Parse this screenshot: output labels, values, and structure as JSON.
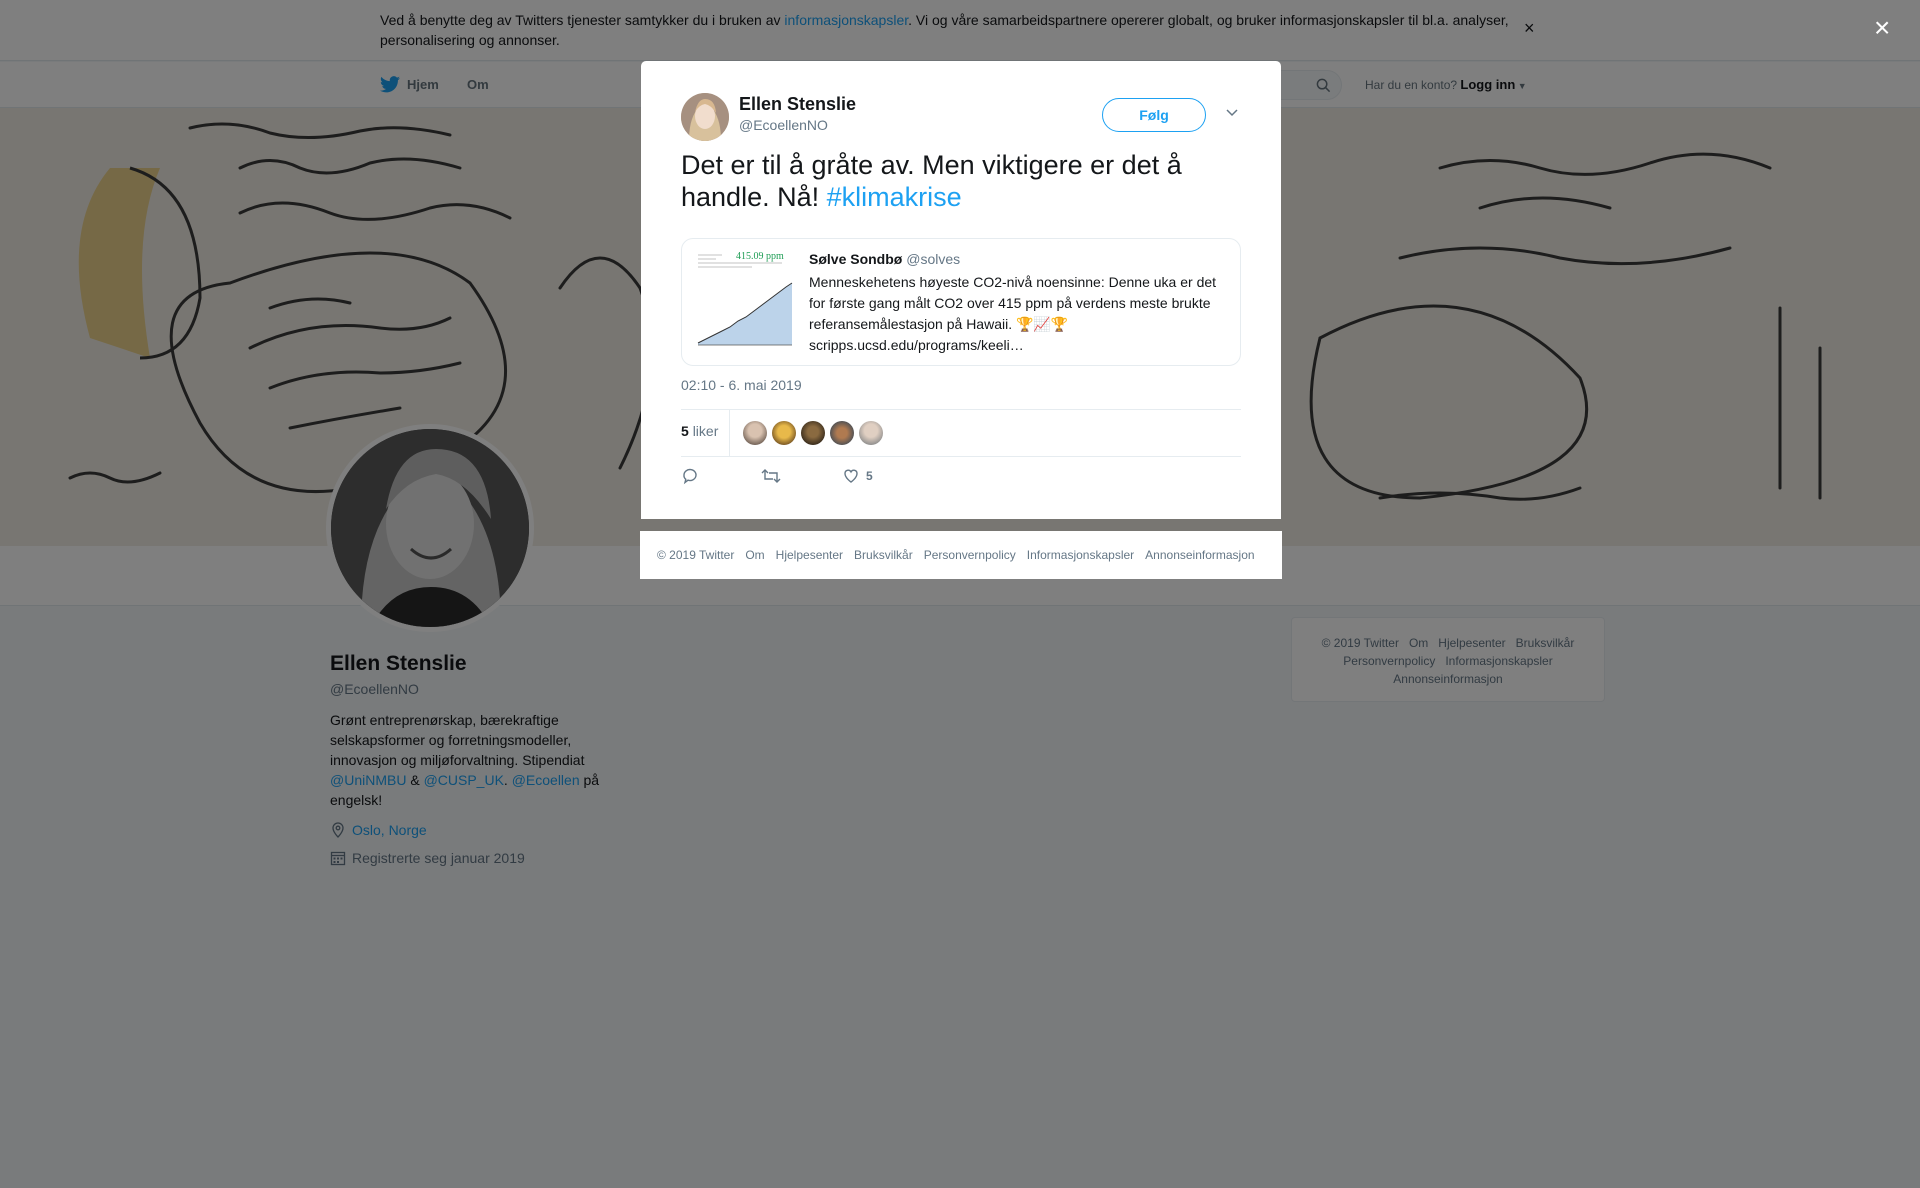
{
  "cookie": {
    "text_before": "Ved å benytte deg av Twitters tjenester samtykker du i bruken av ",
    "link": "informasjonskapsler",
    "text_after": ". Vi og våre samarbeidspartnere opererer globalt, og bruker informasjonskapsler til bl.a. analyser, personalisering og annonser.",
    "close": "×"
  },
  "nav": {
    "home": "Hjem",
    "about": "Om",
    "account_prompt": "Har du en konto?",
    "login": "Logg inn"
  },
  "profile": {
    "name": "Ellen Stenslie",
    "handle": "@EcoellenNO",
    "bio_1": "Grønt entreprenørskap, bærekraftige selskapsformer og forretningsmodeller, innovasjon og miljøforvaltning. Stipendiat ",
    "bio_link_1": "@UniNMBU",
    "bio_amp": " & ",
    "bio_link_2": "@CUSP_UK",
    "bio_dot": ". ",
    "bio_link_3": "@Ecoellen",
    "bio_end": " på engelsk!",
    "location": "Oslo, Norge",
    "joined": "Registrerte seg januar 2019"
  },
  "side_footer": {
    "items": [
      "© 2019 Twitter",
      "Om",
      "Hjelpesenter",
      "Bruksvilkår",
      "Personvernpolicy",
      "Informasjonskapsler",
      "Annonseinformasjon"
    ]
  },
  "tweet": {
    "name": "Ellen Stenslie",
    "handle": "@EcoellenNO",
    "follow": "Følg",
    "text": "Det er til å gråte av. Men viktigere er det å handle. Nå! ",
    "hashtag": "#klimakrise",
    "quote": {
      "name": "Sølve Sondbø",
      "handle": "@solves",
      "text": "Menneskehetens høyeste CO2-nivå noensinne: Denne uka er det for første gang målt CO2 over 415 ppm på verdens meste brukte referansemålestasjon på Hawaii. 🏆📈🏆 scripps.ucsd.edu/programs/keeli…",
      "image_label": "415.09 ppm"
    },
    "time": "02:10 - 6. mai 2019",
    "likes_number": "5",
    "likes_label": "liker",
    "like_action_count": "5"
  },
  "modal_footer": {
    "items": [
      "© 2019 Twitter",
      "Om",
      "Hjelpesenter",
      "Bruksvilkår",
      "Personvernpolicy",
      "Informasjonskapsler",
      "Annonseinformasjon"
    ]
  },
  "overlay_close": "×",
  "colors": {
    "accent": "#1da1f2",
    "overlay": "rgba(0,0,0,0.5)"
  }
}
